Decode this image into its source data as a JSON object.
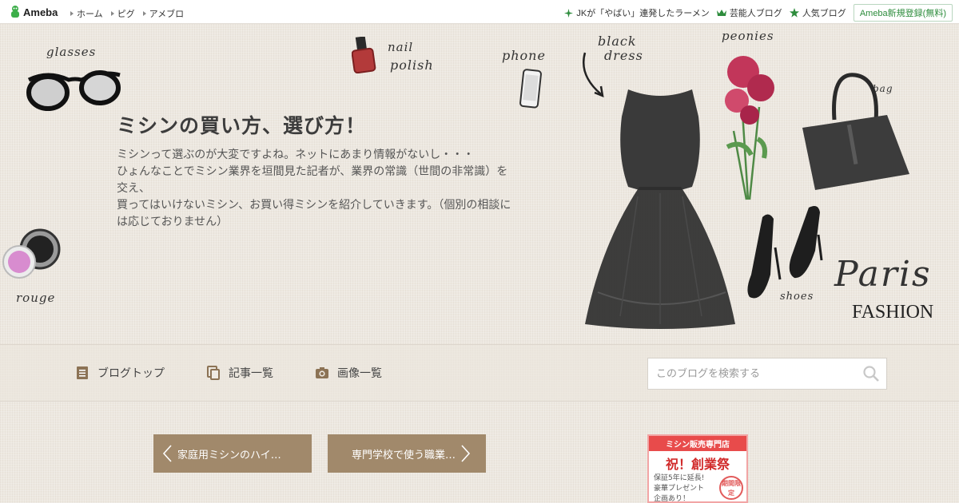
{
  "topbar": {
    "logo_text": "Ameba",
    "links": [
      "ホーム",
      "ピグ",
      "アメブロ"
    ],
    "right_links": [
      "JKが「やばい」連発したラーメン",
      "芸能人ブログ",
      "人気ブログ"
    ],
    "register_label": "Ameba新規登録(無料)"
  },
  "hero": {
    "title": "ミシンの買い方、選び方！",
    "description": [
      "ミシンって選ぶのが大変ですよね。ネットにあまり情報がないし・・・",
      "ひょんなことでミシン業界を垣間見た記者が、業界の常識（世間の非常識）を交え、",
      "買ってはいけないミシン、お買い得ミシンを紹介していきます。（個別の相談には応じておりません）"
    ],
    "illustration_labels": {
      "glasses": "glasses",
      "nail_polish_1": "nail",
      "nail_polish_2": "polish",
      "phone": "phone",
      "black_dress_1": "black",
      "black_dress_2": "dress",
      "peonies": "peonies",
      "bag": "bag",
      "shoes": "shoes",
      "rouge": "rouge",
      "paris": "Paris",
      "fashion": "FASHION"
    }
  },
  "nav": {
    "items": [
      "ブログトップ",
      "記事一覧",
      "画像一覧"
    ],
    "search_placeholder": "このブログを検索する"
  },
  "post_nav": {
    "prev_label": "家庭用ミシンのハイ…",
    "next_label": "専門学校で使う職業…"
  },
  "ad": {
    "header": "ミシン販売専門店",
    "main": "祝！創業祭",
    "line1": "保証5年に延長!",
    "line2": "豪華プレゼント",
    "line3": "企画あり！",
    "stamp": "期間限定"
  },
  "colors": {
    "accent_green": "#2d8c3c",
    "button_brown": "#a1896b",
    "icon_brown": "#8c7355"
  }
}
